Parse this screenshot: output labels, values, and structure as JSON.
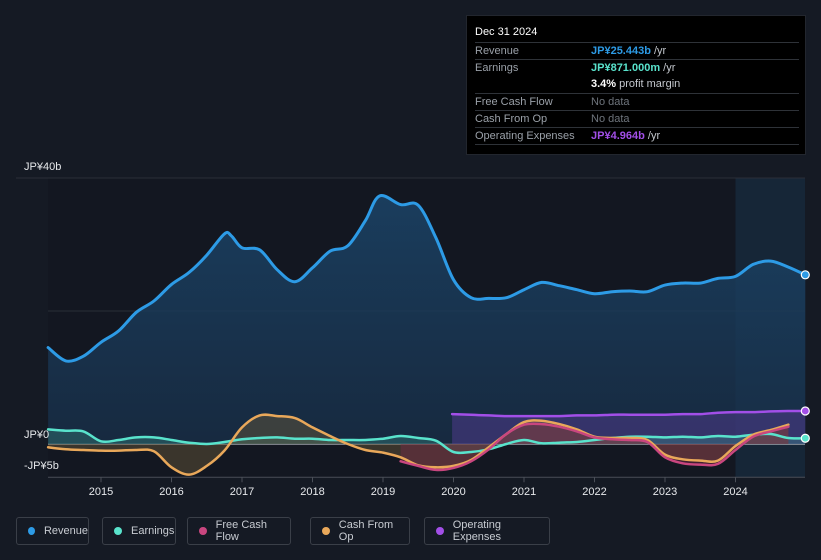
{
  "tooltip": {
    "date": "Dec 31 2024",
    "rows": [
      {
        "label": "Revenue",
        "value": "JP¥25.443b",
        "unit": " /yr",
        "color": "#2d9be6"
      },
      {
        "label": "Earnings",
        "value": "JP¥871.000m",
        "unit": " /yr",
        "color": "#59e3cc"
      },
      {
        "label": "",
        "value": "3.4%",
        "unit": " profit margin",
        "color": "#ffffff"
      },
      {
        "label": "Free Cash Flow",
        "value": "No data",
        "unit": "",
        "color": "#6e747c"
      },
      {
        "label": "Cash From Op",
        "value": "No data",
        "unit": "",
        "color": "#6e747c"
      },
      {
        "label": "Operating Expenses",
        "value": "JP¥4.964b",
        "unit": " /yr",
        "color": "#a24fe8"
      }
    ]
  },
  "legend": [
    {
      "label": "Revenue",
      "color": "#2d9be6"
    },
    {
      "label": "Earnings",
      "color": "#59e3cc"
    },
    {
      "label": "Free Cash Flow",
      "color": "#c9467f"
    },
    {
      "label": "Cash From Op",
      "color": "#e9a85a"
    },
    {
      "label": "Operating Expenses",
      "color": "#a24fe8"
    }
  ],
  "chart_data": {
    "type": "area",
    "title": "",
    "xlabel": "",
    "ylabel": "",
    "ylim": [
      -5,
      40
    ],
    "xlim": [
      2014.25,
      2025.0
    ],
    "y_tick_labels": [
      {
        "value": 40,
        "label": "JP¥40b"
      },
      {
        "value": 0,
        "label": "JP¥0"
      },
      {
        "value": -5,
        "label": "-JP¥5b"
      }
    ],
    "x_ticks": [
      2015,
      2016,
      2017,
      2018,
      2019,
      2020,
      2021,
      2022,
      2023,
      2024
    ],
    "x_tick_labels": [
      "2015",
      "2016",
      "2017",
      "2018",
      "2019",
      "2020",
      "2021",
      "2022",
      "2023",
      "2024"
    ],
    "gridlines": [
      40,
      20,
      0,
      -5
    ],
    "highlight_range": [
      2024.0,
      2025.0
    ],
    "series": [
      {
        "name": "Revenue",
        "color": "#2d9be6",
        "unit": "JP¥ billions",
        "x": [
          2014.25,
          2014.5,
          2014.75,
          2015.0,
          2015.25,
          2015.5,
          2015.75,
          2016.0,
          2016.25,
          2016.5,
          2016.75,
          2016.85,
          2017.0,
          2017.25,
          2017.5,
          2017.75,
          2018.0,
          2018.25,
          2018.5,
          2018.75,
          2018.95,
          2019.25,
          2019.5,
          2019.75,
          2020.0,
          2020.25,
          2020.5,
          2020.75,
          2021.0,
          2021.25,
          2021.5,
          2021.75,
          2022.0,
          2022.25,
          2022.5,
          2022.75,
          2023.0,
          2023.25,
          2023.5,
          2023.75,
          2024.0,
          2024.25,
          2024.5,
          2024.75,
          2024.99
        ],
        "values": [
          14.5,
          12.5,
          13.2,
          15.3,
          17.0,
          19.8,
          21.5,
          24.0,
          25.8,
          28.4,
          31.6,
          31.3,
          29.5,
          29.2,
          26.2,
          24.4,
          26.5,
          29.0,
          29.8,
          33.6,
          37.3,
          36.0,
          35.9,
          31.0,
          24.7,
          22.0,
          21.9,
          22.0,
          23.2,
          24.3,
          23.8,
          23.2,
          22.6,
          22.9,
          23.0,
          22.9,
          23.9,
          24.2,
          24.2,
          24.9,
          25.2,
          27.0,
          27.5,
          26.6,
          25.44
        ]
      },
      {
        "name": "Earnings",
        "color": "#59e3cc",
        "unit": "JP¥ billions",
        "x": [
          2014.25,
          2014.5,
          2014.75,
          2015.0,
          2015.25,
          2015.5,
          2015.75,
          2016.0,
          2016.25,
          2016.5,
          2016.75,
          2017.0,
          2017.25,
          2017.5,
          2017.75,
          2018.0,
          2018.25,
          2018.5,
          2018.75,
          2019.0,
          2019.25,
          2019.5,
          2019.75,
          2020.0,
          2020.25,
          2020.5,
          2020.75,
          2021.0,
          2021.25,
          2021.5,
          2021.75,
          2022.0,
          2022.25,
          2022.5,
          2022.75,
          2023.0,
          2023.25,
          2023.5,
          2023.75,
          2024.0,
          2024.25,
          2024.5,
          2024.75,
          2024.99
        ],
        "values": [
          2.2,
          2.0,
          1.9,
          0.4,
          0.6,
          1.0,
          1.0,
          0.6,
          0.2,
          0.0,
          0.3,
          0.7,
          0.9,
          1.0,
          0.8,
          0.8,
          0.6,
          0.6,
          0.6,
          0.8,
          1.2,
          0.9,
          0.5,
          -1.2,
          -1.2,
          -0.8,
          0.0,
          0.6,
          0.1,
          0.2,
          0.3,
          0.6,
          0.9,
          1.1,
          1.1,
          1.0,
          1.1,
          1.0,
          1.2,
          1.1,
          1.4,
          1.5,
          0.9,
          0.87
        ]
      },
      {
        "name": "Free Cash Flow",
        "color": "#c9467f",
        "unit": "JP¥ billions",
        "x": [
          2019.25,
          2019.5,
          2019.75,
          2020.0,
          2020.25,
          2020.5,
          2020.75,
          2021.0,
          2021.25,
          2021.5,
          2021.75,
          2022.0,
          2022.25,
          2022.5,
          2022.75,
          2023.0,
          2023.25,
          2023.5,
          2023.75,
          2024.0,
          2024.25,
          2024.5,
          2024.75
        ],
        "values": [
          -2.6,
          -3.3,
          -3.9,
          -3.6,
          -2.6,
          -0.8,
          1.5,
          2.9,
          3.0,
          2.6,
          1.9,
          1.0,
          0.7,
          0.6,
          0.3,
          -2.0,
          -2.9,
          -3.1,
          -3.0,
          -0.9,
          1.1,
          1.9,
          2.6
        ]
      },
      {
        "name": "Cash From Op",
        "color": "#e9a85a",
        "unit": "JP¥ billions",
        "x": [
          2014.25,
          2014.5,
          2014.75,
          2015.0,
          2015.25,
          2015.5,
          2015.75,
          2016.0,
          2016.25,
          2016.5,
          2016.75,
          2017.0,
          2017.25,
          2017.5,
          2017.75,
          2018.0,
          2018.25,
          2018.5,
          2018.75,
          2019.0,
          2019.25,
          2019.5,
          2019.75,
          2020.0,
          2020.25,
          2020.5,
          2020.75,
          2021.0,
          2021.25,
          2021.5,
          2021.75,
          2022.0,
          2022.25,
          2022.5,
          2022.75,
          2023.0,
          2023.25,
          2023.5,
          2023.75,
          2024.0,
          2024.25,
          2024.5,
          2024.75
        ],
        "values": [
          -0.5,
          -0.8,
          -0.9,
          -1.0,
          -1.0,
          -0.9,
          -1.1,
          -3.5,
          -4.6,
          -3.3,
          -1.0,
          2.5,
          4.3,
          4.2,
          3.9,
          2.5,
          1.2,
          0.0,
          -0.9,
          -1.3,
          -2.0,
          -3.2,
          -3.5,
          -3.3,
          -2.4,
          -0.5,
          1.5,
          3.3,
          3.5,
          3.0,
          2.2,
          1.1,
          0.9,
          0.9,
          0.6,
          -1.6,
          -2.3,
          -2.5,
          -2.5,
          -0.3,
          1.4,
          2.1,
          2.9
        ]
      },
      {
        "name": "Operating Expenses",
        "color": "#a24fe8",
        "unit": "JP¥ billions",
        "x": [
          2019.98,
          2020.25,
          2020.5,
          2020.75,
          2021.0,
          2021.25,
          2021.5,
          2021.75,
          2022.0,
          2022.25,
          2022.5,
          2022.75,
          2023.0,
          2023.25,
          2023.5,
          2023.75,
          2024.0,
          2024.25,
          2024.5,
          2024.75,
          2024.99
        ],
        "values": [
          4.5,
          4.4,
          4.3,
          4.2,
          4.2,
          4.2,
          4.2,
          4.3,
          4.3,
          4.4,
          4.4,
          4.4,
          4.4,
          4.5,
          4.5,
          4.7,
          4.8,
          4.8,
          4.9,
          4.96,
          4.96
        ]
      }
    ]
  }
}
